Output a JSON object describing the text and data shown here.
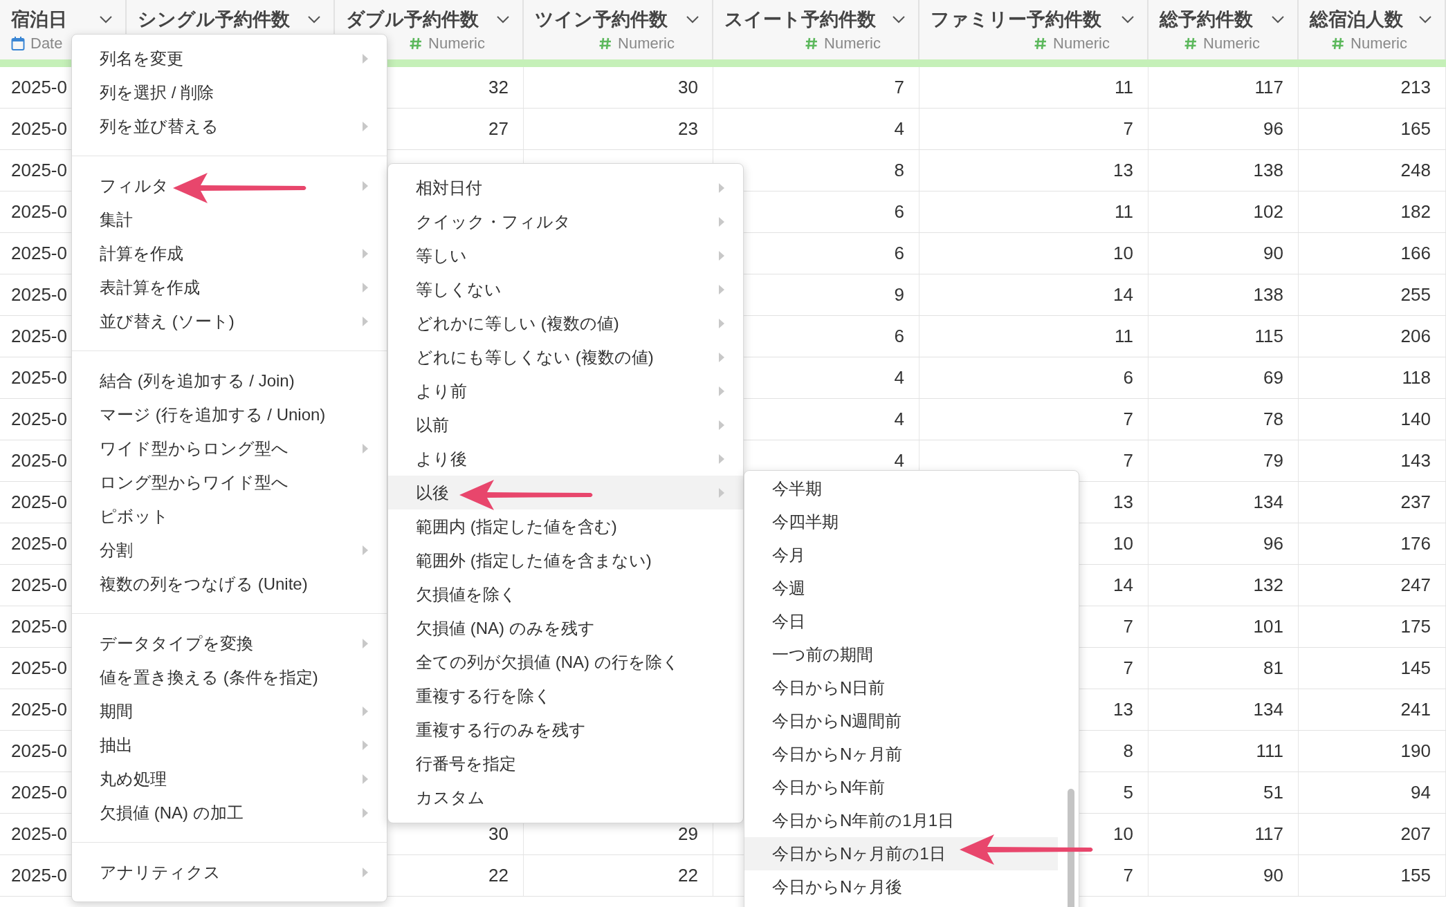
{
  "table": {
    "columns": [
      {
        "name": "宿泊日",
        "kind": "date",
        "type_label": "Date"
      },
      {
        "name": "シングル予約件数"
      },
      {
        "name": "ダブル予約件数",
        "kind": "numeric",
        "type_label": "Numeric"
      },
      {
        "name": "ツイン予約件数",
        "kind": "numeric",
        "type_label": "Numeric"
      },
      {
        "name": "スイート予約件数",
        "kind": "numeric",
        "type_label": "Numeric"
      },
      {
        "name": "ファミリー予約件数",
        "kind": "numeric",
        "type_label": "Numeric"
      },
      {
        "name": "総予約件数",
        "kind": "numeric",
        "type_label": "Numeric"
      },
      {
        "name": "総宿泊人数",
        "kind": "numeric",
        "type_label": "Numeric"
      }
    ],
    "rows": [
      {
        "stay_date": "2025-0",
        "double": "32",
        "twin": "30",
        "suite": "7",
        "family": "11",
        "total": "117",
        "guests": "213"
      },
      {
        "stay_date": "2025-0",
        "double": "27",
        "twin": "23",
        "suite": "4",
        "family": "7",
        "total": "96",
        "guests": "165"
      },
      {
        "stay_date": "2025-0",
        "suite": "8",
        "family": "13",
        "total": "138",
        "guests": "248"
      },
      {
        "stay_date": "2025-0",
        "suite": "6",
        "family": "11",
        "total": "102",
        "guests": "182"
      },
      {
        "stay_date": "2025-0",
        "suite": "6",
        "family": "10",
        "total": "90",
        "guests": "166"
      },
      {
        "stay_date": "2025-0",
        "suite": "9",
        "family": "14",
        "total": "138",
        "guests": "255"
      },
      {
        "stay_date": "2025-0",
        "suite": "6",
        "family": "11",
        "total": "115",
        "guests": "206"
      },
      {
        "stay_date": "2025-0",
        "suite": "4",
        "family": "6",
        "total": "69",
        "guests": "118"
      },
      {
        "stay_date": "2025-0",
        "suite": "4",
        "family": "7",
        "total": "78",
        "guests": "140"
      },
      {
        "stay_date": "2025-0",
        "suite": "4",
        "family": "7",
        "total": "79",
        "guests": "143"
      },
      {
        "stay_date": "2025-0",
        "family": "13",
        "total": "134",
        "guests": "237"
      },
      {
        "stay_date": "2025-0",
        "family": "10",
        "total": "96",
        "guests": "176"
      },
      {
        "stay_date": "2025-0",
        "family": "14",
        "total": "132",
        "guests": "247"
      },
      {
        "stay_date": "2025-0",
        "family": "7",
        "total": "101",
        "guests": "175"
      },
      {
        "stay_date": "2025-0",
        "family": "7",
        "total": "81",
        "guests": "145"
      },
      {
        "stay_date": "2025-0",
        "family": "13",
        "total": "134",
        "guests": "241"
      },
      {
        "stay_date": "2025-0",
        "family": "8",
        "total": "111",
        "guests": "190"
      },
      {
        "stay_date": "2025-0",
        "family": "5",
        "total": "51",
        "guests": "94"
      },
      {
        "stay_date": "2025-0",
        "double": "30",
        "twin": "29",
        "family": "10",
        "total": "117",
        "guests": "207"
      },
      {
        "stay_date": "2025-0",
        "double": "22",
        "twin": "22",
        "family": "7",
        "total": "90",
        "guests": "155"
      }
    ]
  },
  "column_menu": {
    "sections": [
      [
        {
          "label": "列名を変更",
          "submenu": true
        },
        {
          "label": "列を選択 / 削除",
          "submenu": false
        },
        {
          "label": "列を並び替える",
          "submenu": true
        }
      ],
      [
        {
          "label": "フィルタ",
          "submenu": true
        },
        {
          "label": "集計",
          "submenu": false
        },
        {
          "label": "計算を作成",
          "submenu": true
        },
        {
          "label": "表計算を作成",
          "submenu": true
        },
        {
          "label": "並び替え (ソート)",
          "submenu": true
        }
      ],
      [
        {
          "label": "結合 (列を追加する / Join)",
          "submenu": false
        },
        {
          "label": "マージ (行を追加する / Union)",
          "submenu": false
        },
        {
          "label": "ワイド型からロング型へ",
          "submenu": true
        },
        {
          "label": "ロング型からワイド型へ",
          "submenu": false
        },
        {
          "label": "ピボット",
          "submenu": false
        },
        {
          "label": "分割",
          "submenu": true
        },
        {
          "label": "複数の列をつなげる (Unite)",
          "submenu": false
        }
      ],
      [
        {
          "label": "データタイプを変換",
          "submenu": true
        },
        {
          "label": "値を置き換える (条件を指定)",
          "submenu": false
        },
        {
          "label": "期間",
          "submenu": true
        },
        {
          "label": "抽出",
          "submenu": true
        },
        {
          "label": "丸め処理",
          "submenu": true
        },
        {
          "label": "欠損値 (NA) の加工",
          "submenu": true
        }
      ],
      [
        {
          "label": "アナリティクス",
          "submenu": true
        }
      ]
    ]
  },
  "filter_menu": {
    "items": [
      {
        "label": "相対日付",
        "submenu": true,
        "selected": false
      },
      {
        "label": "クイック・フィルタ",
        "submenu": true,
        "selected": false
      },
      {
        "label": "等しい",
        "submenu": true,
        "selected": false
      },
      {
        "label": "等しくない",
        "submenu": true,
        "selected": false
      },
      {
        "label": "どれかに等しい (複数の値)",
        "submenu": true,
        "selected": false
      },
      {
        "label": "どれにも等しくない (複数の値)",
        "submenu": true,
        "selected": false
      },
      {
        "label": "より前",
        "submenu": true,
        "selected": false
      },
      {
        "label": "以前",
        "submenu": true,
        "selected": false
      },
      {
        "label": "より後",
        "submenu": true,
        "selected": false
      },
      {
        "label": "以後",
        "submenu": true,
        "selected": true
      },
      {
        "label": "範囲内 (指定した値を含む)",
        "submenu": false,
        "selected": false
      },
      {
        "label": "範囲外 (指定した値を含まない)",
        "submenu": false,
        "selected": false
      },
      {
        "label": "欠損値を除く",
        "submenu": false,
        "selected": false
      },
      {
        "label": "欠損値 (NA) のみを残す",
        "submenu": false,
        "selected": false
      },
      {
        "label": "全ての列が欠損値 (NA) の行を除く",
        "submenu": false,
        "selected": false
      },
      {
        "label": "重複する行を除く",
        "submenu": false,
        "selected": false
      },
      {
        "label": "重複する行のみを残す",
        "submenu": false,
        "selected": false
      },
      {
        "label": "行番号を指定",
        "submenu": false,
        "selected": false
      },
      {
        "label": "カスタム",
        "submenu": false,
        "selected": false
      }
    ]
  },
  "period_menu": {
    "items": [
      {
        "label": "今半期",
        "selected": false
      },
      {
        "label": "今四半期",
        "selected": false
      },
      {
        "label": "今月",
        "selected": false
      },
      {
        "label": "今週",
        "selected": false
      },
      {
        "label": "今日",
        "selected": false
      },
      {
        "label": "一つ前の期間",
        "selected": false
      },
      {
        "label": "今日からN日前",
        "selected": false
      },
      {
        "label": "今日からN週間前",
        "selected": false
      },
      {
        "label": "今日からNヶ月前",
        "selected": false
      },
      {
        "label": "今日からN年前",
        "selected": false
      },
      {
        "label": "今日からN年前の1月1日",
        "selected": false
      },
      {
        "label": "今日からNヶ月前の1日",
        "selected": true
      },
      {
        "label": "今日からNヶ月後",
        "selected": false
      }
    ]
  }
}
